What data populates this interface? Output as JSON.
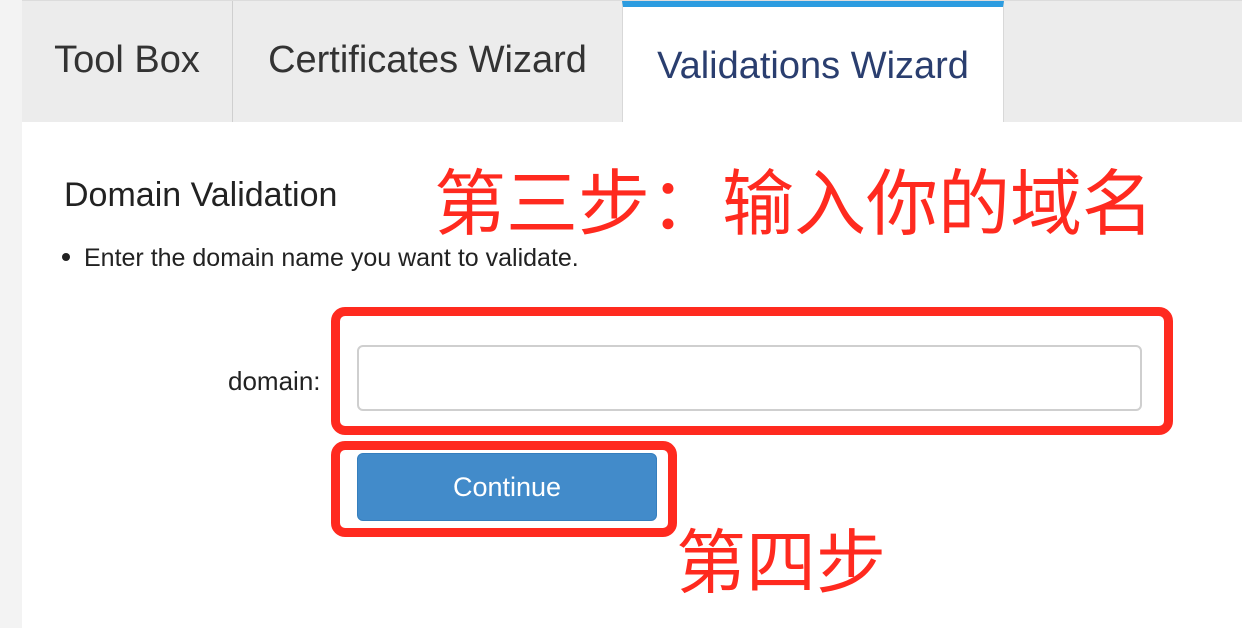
{
  "tabs": [
    {
      "label": "Tool Box",
      "active": false
    },
    {
      "label": "Certificates Wizard",
      "active": false
    },
    {
      "label": "Validations Wizard",
      "active": true
    }
  ],
  "main": {
    "heading": "Domain Validation",
    "instructions": [
      "Enter the domain name you want to validate."
    ],
    "domain_label": "domain:",
    "domain_value": "",
    "domain_placeholder": "",
    "continue_label": "Continue"
  },
  "annotations": {
    "step3": "第三步：输入你的域名",
    "step4": "第四步"
  },
  "colors": {
    "annotation": "#ff2a1f",
    "primary_button": "#428bca",
    "active_tab_accent": "#2c9ce0",
    "active_tab_text": "#2a3e6f"
  }
}
